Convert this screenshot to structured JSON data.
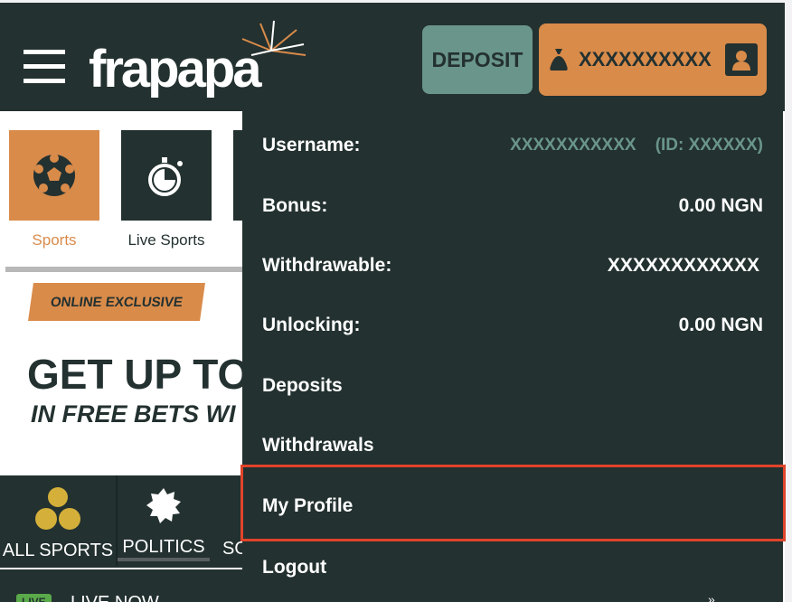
{
  "header": {
    "logo": "frapapa",
    "deposit_label": "DEPOSIT",
    "balance": "XXXXXXXXXX"
  },
  "sports_tiles": [
    {
      "label": "Sports",
      "active": true
    },
    {
      "label": "Live Sports",
      "active": false
    }
  ],
  "banner": {
    "badge": "ONLINE EXCLUSIVE",
    "headline": "GET UP TO",
    "subline": "IN FREE BETS WI"
  },
  "categories": [
    {
      "label": "ALL SPORTS"
    },
    {
      "label": "POLITICS"
    },
    {
      "label": "SO"
    }
  ],
  "live": {
    "badge": "LIVE",
    "label": "LIVE NOW"
  },
  "account_menu": {
    "username_label": "Username:",
    "username_value": "XXXXXXXXXXX",
    "id_value": "(ID: XXXXXX)",
    "bonus_label": "Bonus:",
    "bonus_value": "0.00 NGN",
    "withdrawable_label": "Withdrawable:",
    "withdrawable_value": "XXXXXXXXXXXX",
    "unlocking_label": "Unlocking:",
    "unlocking_value": "0.00 NGN",
    "items": [
      "Deposits",
      "Withdrawals",
      "My Profile",
      "Logout"
    ],
    "highlighted": "My Profile"
  },
  "colors": {
    "dark": "#233130",
    "orange": "#d98b4a",
    "teal": "#6a958b",
    "highlight": "#e0442a"
  }
}
